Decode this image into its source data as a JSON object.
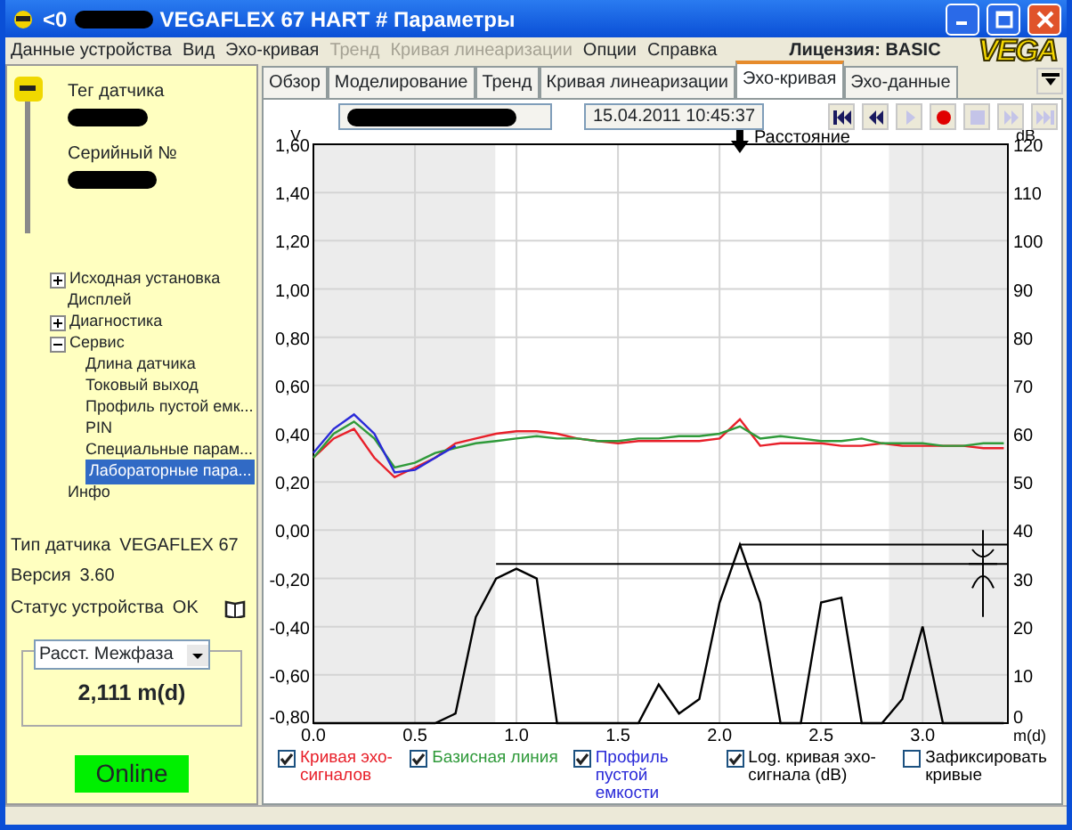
{
  "window": {
    "title_prefix": "<0",
    "title": "VEGAFLEX 67 HART # Параметры"
  },
  "menu": [
    {
      "label": "Данные устройства",
      "disabled": false
    },
    {
      "label": "Вид",
      "disabled": false
    },
    {
      "label": "Эхо-кривая",
      "disabled": false
    },
    {
      "label": "Тренд",
      "disabled": true
    },
    {
      "label": "Кривая линеаризации",
      "disabled": true
    },
    {
      "label": "Опции",
      "disabled": false
    },
    {
      "label": "Справка",
      "disabled": false
    }
  ],
  "license": "Лицензия: BASIC",
  "logo": "VEGA",
  "sensor": {
    "tag_label": "Тег датчика",
    "serial_label": "Серийный №"
  },
  "tree": [
    {
      "label": "Исходная установка",
      "expanded": false,
      "selected": false
    },
    {
      "label": "Дисплей",
      "selected": false
    },
    {
      "label": "Диагностика",
      "expanded": false,
      "selected": false
    },
    {
      "label": "Сервис",
      "expanded": true,
      "selected": false,
      "children": [
        {
          "label": "Длина датчика",
          "selected": false
        },
        {
          "label": "Токовый выход",
          "selected": false
        },
        {
          "label": "Профиль пустой емк...",
          "selected": false
        },
        {
          "label": "PIN",
          "selected": false
        },
        {
          "label": "Специальные парам...",
          "selected": false
        },
        {
          "label": "Лабораторные пара...",
          "selected": true
        }
      ]
    },
    {
      "label": "Инфо",
      "selected": false
    }
  ],
  "device_info": [
    {
      "label": "Тип датчика",
      "value": "VEGAFLEX 67"
    },
    {
      "label": "Версия",
      "value": "3.60"
    },
    {
      "label": "Статус устройства",
      "value": "OK"
    }
  ],
  "measurement": {
    "selector": "Расст. Межфаза",
    "value": "2,111 m(d)"
  },
  "connection": "Online",
  "tabs": [
    {
      "label": "Обзор",
      "selected": false
    },
    {
      "label": "Моделирование",
      "selected": false
    },
    {
      "label": "Тренд",
      "selected": false
    },
    {
      "label": "Кривая линеаризации",
      "selected": false
    },
    {
      "label": "Эхо-кривая",
      "selected": true
    },
    {
      "label": "Эхо-данные",
      "selected": false
    }
  ],
  "toolbar": {
    "timestamp": "15.04.2011 10:45:37",
    "buttons": [
      {
        "kind": "first",
        "disabled": false
      },
      {
        "kind": "back",
        "disabled": false
      },
      {
        "kind": "play",
        "disabled": true
      },
      {
        "kind": "record",
        "disabled": false
      },
      {
        "kind": "stop",
        "disabled": true
      },
      {
        "kind": "forward",
        "disabled": true
      },
      {
        "kind": "last",
        "disabled": true
      }
    ]
  },
  "chart_data": {
    "type": "line",
    "ylabel": "V",
    "y2label": "dB",
    "xlabel": "m(d)",
    "x": [
      0,
      0.1,
      0.2,
      0.3,
      0.4,
      0.5,
      0.6,
      0.7,
      0.8,
      0.9,
      1.0,
      1.1,
      1.2,
      1.3,
      1.4,
      1.5,
      1.6,
      1.7,
      1.8,
      1.9,
      2.0,
      2.1,
      2.2,
      2.3,
      2.4,
      2.5,
      2.6,
      2.7,
      2.8,
      2.9,
      3.0,
      3.1,
      3.2,
      3.3,
      3.4
    ],
    "xlim": [
      0,
      3.42
    ],
    "ylim": [
      -0.8,
      1.6
    ],
    "y2lim": [
      0,
      120
    ],
    "xticks": [
      {
        "value": 0,
        "label": "0.0"
      },
      {
        "value": 0.5,
        "label": "0.5"
      },
      {
        "value": 1,
        "label": "1.0"
      },
      {
        "value": 1.5,
        "label": "1.5"
      },
      {
        "value": 2,
        "label": "2.0"
      },
      {
        "value": 2.5,
        "label": "2.5"
      },
      {
        "value": 3,
        "label": "3.0"
      }
    ],
    "yticks": [
      {
        "value": 1.6,
        "label": "1,60"
      },
      {
        "value": 1.4,
        "label": "1,40"
      },
      {
        "value": 1.2,
        "label": "1,20"
      },
      {
        "value": 1,
        "label": "1,00"
      },
      {
        "value": 0.8,
        "label": "0,80"
      },
      {
        "value": 0.6,
        "label": "0,60"
      },
      {
        "value": 0.4,
        "label": "0,40"
      },
      {
        "value": 0.2,
        "label": "0,20"
      },
      {
        "value": 0,
        "label": "0,00"
      },
      {
        "value": -0.2,
        "label": "-0,20"
      },
      {
        "value": -0.4,
        "label": "-0,40"
      },
      {
        "value": -0.6,
        "label": "-0,60"
      },
      {
        "value": -0.8,
        "label": "-0,80"
      }
    ],
    "y2ticks": [
      {
        "value": 120,
        "label": "120"
      },
      {
        "value": 110,
        "label": "110"
      },
      {
        "value": 100,
        "label": "100"
      },
      {
        "value": 90,
        "label": "90"
      },
      {
        "value": 80,
        "label": "80"
      },
      {
        "value": 70,
        "label": "70"
      },
      {
        "value": 60,
        "label": "60"
      },
      {
        "value": 50,
        "label": "50"
      },
      {
        "value": 40,
        "label": "40"
      },
      {
        "value": 30,
        "label": "30"
      },
      {
        "value": 20,
        "label": "20"
      },
      {
        "value": 10,
        "label": "10"
      },
      {
        "value": 0,
        "label": "0"
      }
    ],
    "series": [
      {
        "name": "Кривая эхо-сигналов",
        "color": "#e8202a",
        "values": [
          0.3,
          0.38,
          0.42,
          0.3,
          0.22,
          0.26,
          0.3,
          0.36,
          0.38,
          0.4,
          0.41,
          0.41,
          0.4,
          0.38,
          0.37,
          0.36,
          0.37,
          0.37,
          0.37,
          0.37,
          0.38,
          0.46,
          0.35,
          0.36,
          0.36,
          0.36,
          0.35,
          0.35,
          0.36,
          0.35,
          0.35,
          0.35,
          0.35,
          0.34,
          0.34
        ]
      },
      {
        "name": "Базисная линия",
        "color": "#2f9a3a",
        "values": [
          0.3,
          0.4,
          0.45,
          0.38,
          0.26,
          0.28,
          0.32,
          0.34,
          0.36,
          0.37,
          0.38,
          0.39,
          0.38,
          0.38,
          0.37,
          0.37,
          0.38,
          0.38,
          0.39,
          0.39,
          0.4,
          0.43,
          0.38,
          0.39,
          0.38,
          0.37,
          0.37,
          0.38,
          0.36,
          0.36,
          0.36,
          0.35,
          0.35,
          0.36,
          0.36
        ]
      },
      {
        "name": "Профиль пустой емкости",
        "color": "#2a2ad8",
        "values": [
          0.32,
          0.42,
          0.48,
          0.4,
          0.24,
          0.25,
          0.3,
          0.35,
          null,
          null,
          null,
          null,
          null,
          null,
          null,
          null,
          null,
          null,
          null,
          null,
          null,
          null,
          null,
          null,
          null,
          null,
          null,
          null,
          null,
          null,
          null,
          null,
          null,
          null,
          null
        ]
      },
      {
        "name": "Log. кривая эхо-сигнала (dB)",
        "color": "#000000",
        "axis": "y2",
        "values": [
          0,
          0,
          0,
          0,
          0,
          0,
          0,
          2,
          22,
          30,
          32,
          30,
          0,
          0,
          0,
          0,
          0,
          8,
          2,
          5,
          25,
          37,
          25,
          0,
          0,
          25,
          26,
          0,
          0,
          5,
          20,
          0,
          0,
          0,
          0
        ]
      }
    ],
    "grid": true,
    "bands": [
      {
        "axis": "x",
        "from": 0,
        "to": 0.9
      },
      {
        "axis": "x",
        "from": 2.83,
        "to": 3.42
      }
    ],
    "ref_lines": [
      {
        "axis": "y2",
        "value": 37
      },
      {
        "axis": "y2",
        "value": 33
      }
    ],
    "annotations": [
      {
        "x": 2.1,
        "text": "Расстояние"
      }
    ]
  },
  "legend": [
    {
      "checked": true
    },
    {
      "checked": true
    },
    {
      "checked": true
    },
    {
      "checked": true
    }
  ],
  "freeze_curves": {
    "label": "Зафиксировать кривые",
    "checked": false
  }
}
